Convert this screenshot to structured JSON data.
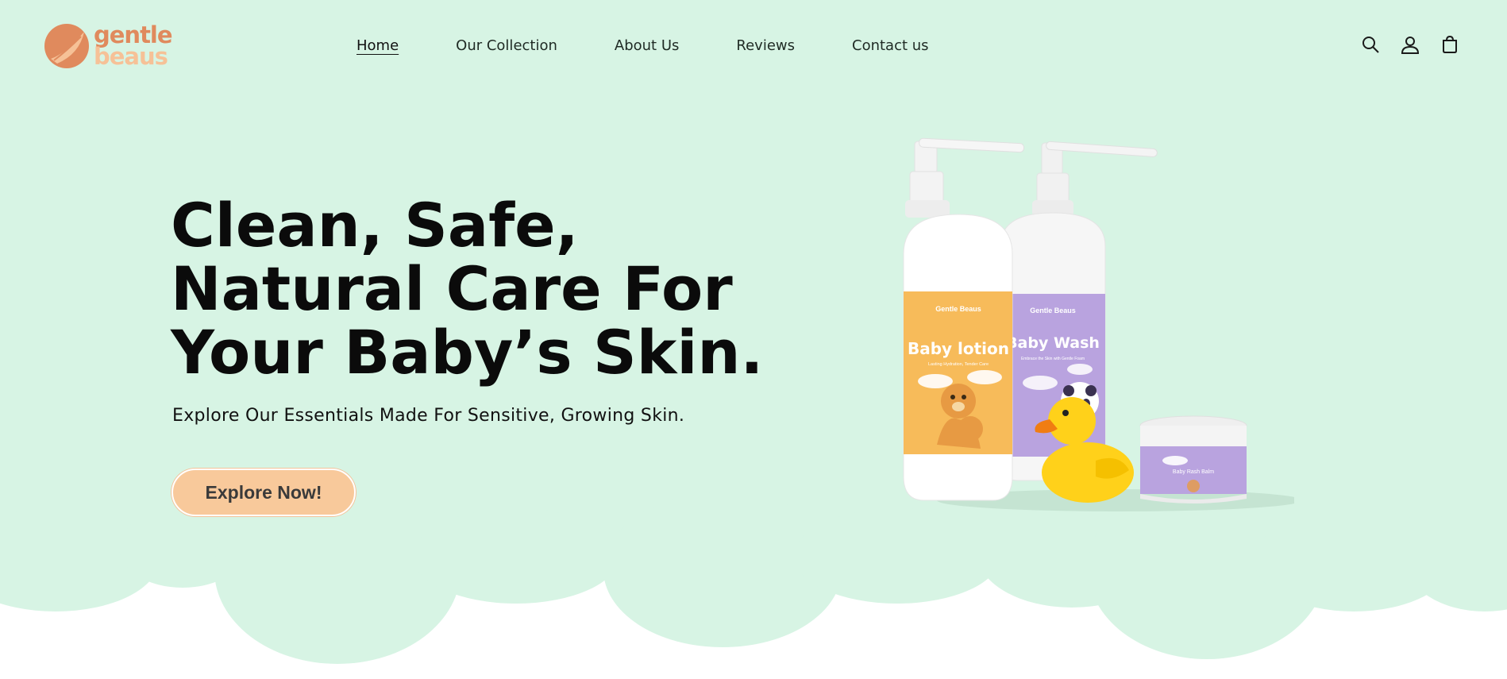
{
  "brand": {
    "name_line1": "gentle",
    "name_line2": "beaus",
    "primary_color": "#e08a5d",
    "secondary_color": "#f6c197"
  },
  "nav": {
    "items": [
      {
        "label": "Home",
        "active": true
      },
      {
        "label": "Our Collection",
        "active": false
      },
      {
        "label": "About Us",
        "active": false
      },
      {
        "label": "Reviews",
        "active": false
      },
      {
        "label": "Contact us",
        "active": false
      }
    ]
  },
  "header_icons": [
    "search-icon",
    "account-icon",
    "cart-icon"
  ],
  "hero": {
    "headline_lines": [
      "Clean, Safe,",
      "Natural Care For",
      "Your Baby’s Skin."
    ],
    "subheadline": "Explore Our Essentials Made For Sensitive, Growing Skin.",
    "cta_label": "Explore Now!",
    "background_color": "#d7f4e4",
    "cta_color": "#f8c99b"
  },
  "products": {
    "lotion": {
      "brand": "Gentle Beaus",
      "name": "Baby lotion",
      "tagline": "Lasting Hydration, Tender Care",
      "color": "#f7bb5a"
    },
    "wash": {
      "brand": "Gentle Beaus",
      "name": "Baby Wash",
      "tagline": "Embrace the Skin with Gentle Foam",
      "color": "#b9a3df"
    },
    "balm": {
      "name": "Baby Rash Balm",
      "color": "#b9a3df"
    }
  }
}
